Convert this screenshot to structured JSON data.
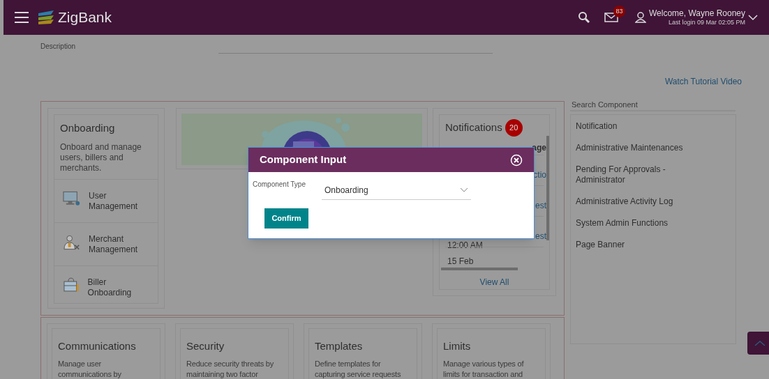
{
  "header": {
    "brand": "ZigBank",
    "mail_count": "83",
    "welcome": "Welcome, Wayne Rooney",
    "last_login": "Last login 09 Mar 02:05 PM"
  },
  "description_label": "Description",
  "tutorial_link": "Watch Tutorial Video",
  "onboarding": {
    "title": "Onboarding",
    "text": "Onboard and manage users, billers and merchants.",
    "items": [
      {
        "kind": "monitor",
        "label": "User Management"
      },
      {
        "kind": "merchant",
        "label": "Merchant Management"
      },
      {
        "kind": "biller",
        "label": "Biller Onboarding"
      }
    ]
  },
  "notifications": {
    "title": "Notifications",
    "count": "20",
    "column_2_visible": "age",
    "rows": [
      {
        "date": "",
        "message": "ctio"
      },
      {
        "date": "",
        "message": "est"
      },
      {
        "date": "12:00 AM",
        "message": "est"
      },
      {
        "date": "15 Feb",
        "message": ""
      }
    ],
    "view_all": "View All"
  },
  "search_component": {
    "title": "Search Component",
    "items": [
      "Notification",
      "Administrative Maintenances",
      "Pending For Approvals - Administrator",
      "Administrative Activity Log",
      "System Admin Functions",
      "Page Banner"
    ]
  },
  "bottom_cards": [
    {
      "title": "Communications",
      "text": "Manage user communications by"
    },
    {
      "title": "Security",
      "text": "Reduce security threats by maintaining two factor"
    },
    {
      "title": "Templates",
      "text": "Define templates for capturing service requests"
    },
    {
      "title": "Limits",
      "text": "Manage various types of limits for transaction and"
    }
  ],
  "modal": {
    "title": "Component Input",
    "field_label": "Component Type",
    "field_value": "Onboarding",
    "confirm": "Confirm"
  }
}
